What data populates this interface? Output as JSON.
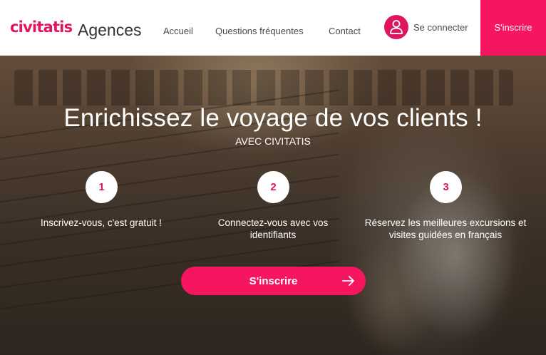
{
  "header": {
    "logo": "civitatis",
    "logo_sub": "Agences",
    "nav": {
      "home": "Accueil",
      "faq": "Questions fréquentes",
      "contact": "Contact"
    },
    "login_label": "Se connecter",
    "signup_label": "S'inscrire"
  },
  "hero": {
    "title": "Enrichissez le voyage de vos clients !",
    "subtitle": "AVEC CIVITATIS",
    "steps": [
      {
        "number": "1",
        "text": "Inscrivez-vous, c'est gratuit !"
      },
      {
        "number": "2",
        "text": "Connectez-vous avec vos identifiants"
      },
      {
        "number": "3",
        "text": "Réservez les meilleures excursions et visites guidées en français"
      }
    ],
    "cta_label": "S'inscrire"
  },
  "colors": {
    "brand": "#e0155f",
    "cta": "#f5165f"
  },
  "icons": {
    "user": "user-icon",
    "arrow": "arrow-right-icon"
  }
}
